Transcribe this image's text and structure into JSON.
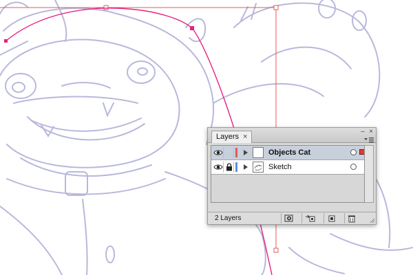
{
  "canvas": {
    "sketch_color": "#b8b8dc",
    "path_color": "#e8207e",
    "bbox_color": "#e25a5a"
  },
  "panel": {
    "tab_label": "Layers",
    "tab_close_icon": "×",
    "collapse_icon": "–",
    "close_icon": "×",
    "layers": [
      {
        "name": "Objects Cat",
        "color": "#e05a5a",
        "selected": true,
        "locked": false,
        "visible": true,
        "icon_expand": "triangle-right-icon"
      },
      {
        "name": "Sketch",
        "color": "#5a90e0",
        "selected": false,
        "locked": true,
        "visible": true,
        "icon_expand": "triangle-right-icon"
      }
    ],
    "footer": {
      "layer_count": "2 Layers"
    }
  }
}
